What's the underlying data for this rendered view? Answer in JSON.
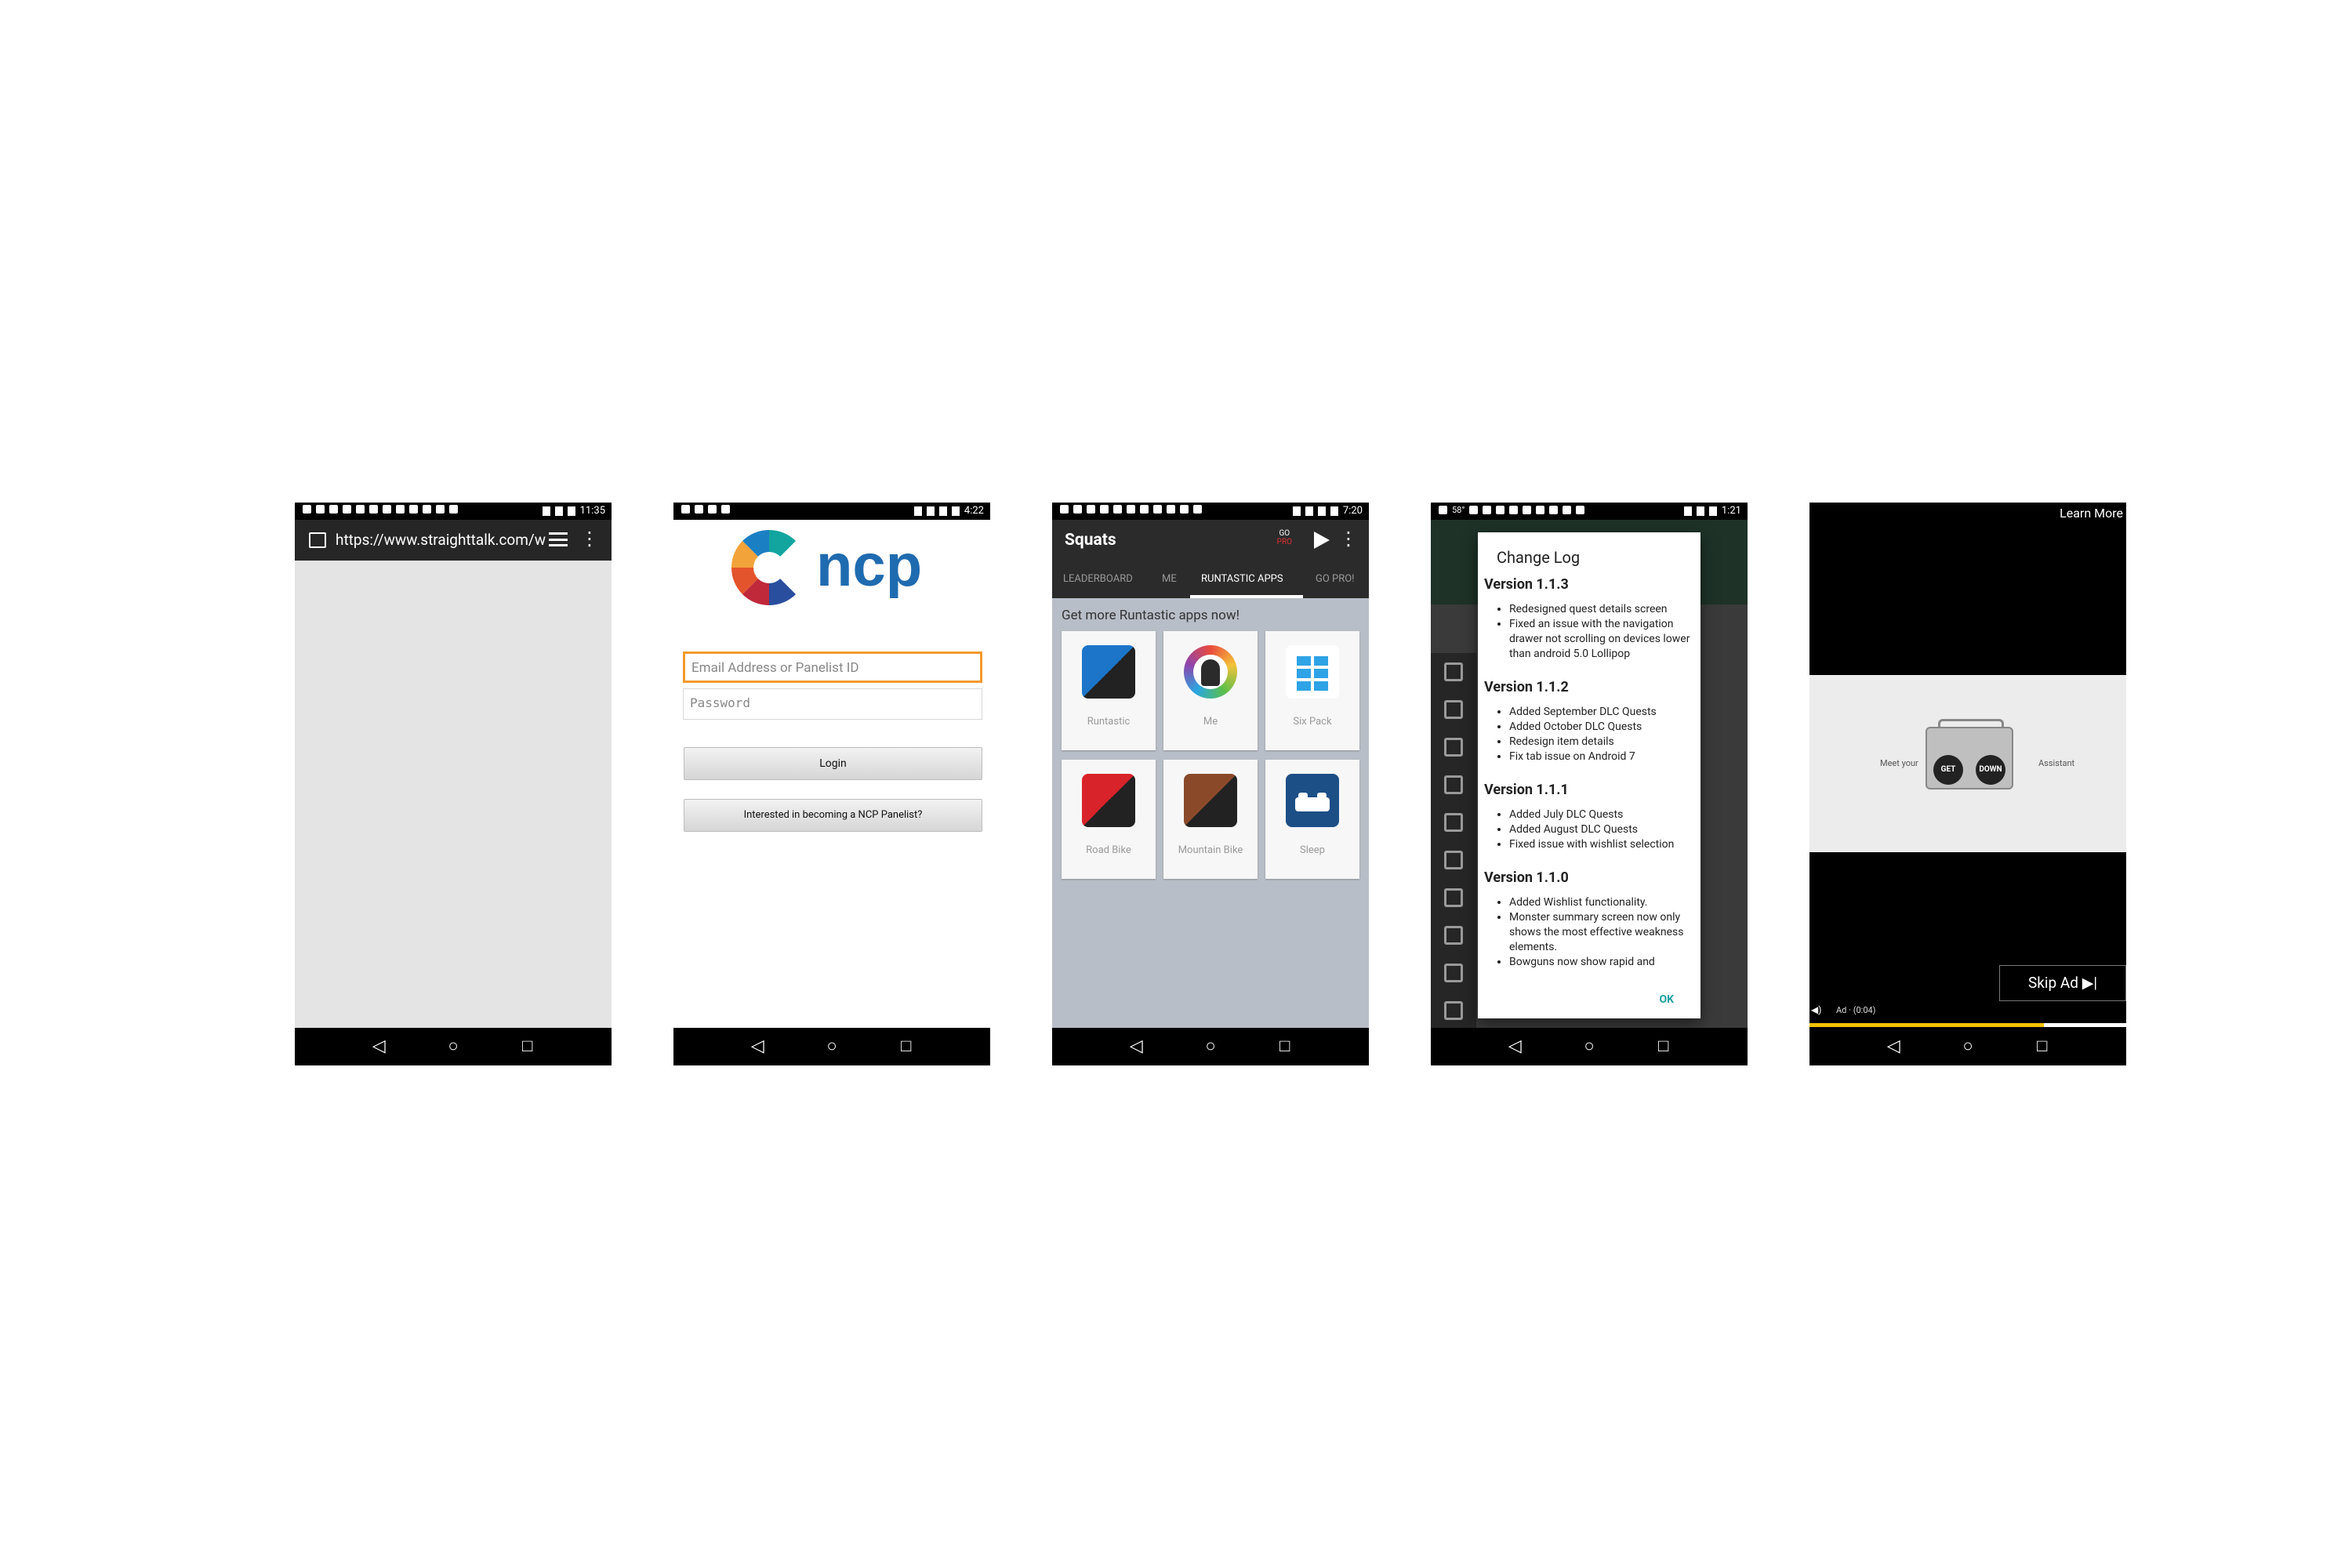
{
  "phone1": {
    "status_time": "11:35",
    "url": "https://www.straighttalk.com/w"
  },
  "phone2": {
    "status_time": "4:22",
    "logo_text": "ncp",
    "email_placeholder": "Email Address or Panelist ID",
    "password_placeholder": "Password",
    "login_label": "Login",
    "panelist_label": "Interested in becoming a NCP Panelist?"
  },
  "phone3": {
    "status_time": "7:20",
    "title": "Squats",
    "gopro_top": "GO",
    "gopro_bottom": "PRO",
    "tabs": [
      "LEADERBOARD",
      "ME",
      "RUNTASTIC APPS",
      "GO PRO!"
    ],
    "heading": "Get more Runtastic apps now!",
    "apps": [
      "Runtastic",
      "Me",
      "Six Pack",
      "Road Bike",
      "Mountain Bike",
      "Sleep"
    ]
  },
  "phone4": {
    "status_temp": "58°",
    "status_time": "1:21",
    "dialog_title": "Change Log",
    "versions": [
      {
        "title": "Version 1.1.3",
        "items": [
          "Redesigned quest details screen",
          "Fixed an issue with the navigation drawer not scrolling on devices lower than android 5.0 Lollipop"
        ]
      },
      {
        "title": "Version 1.1.2",
        "items": [
          "Added September DLC Quests",
          "Added October DLC Quests",
          "Redesign item details",
          "Fix tab issue on Android 7"
        ]
      },
      {
        "title": "Version 1.1.1",
        "items": [
          "Added July DLC Quests",
          "Added August DLC Quests",
          "Fixed issue with wishlist selection"
        ]
      },
      {
        "title": "Version 1.1.0",
        "items": [
          "Added Wishlist functionality.",
          "Monster summary screen now only shows the most effective weakness elements.",
          "Bowguns now show rapid and"
        ]
      }
    ],
    "ok_label": "OK"
  },
  "phone5": {
    "learn_more": "Learn More",
    "ad_left": "Meet your",
    "ad_right": "Assistant",
    "boombox_left": "GET",
    "boombox_right": "DOWN",
    "skip_label": "Skip Ad ▶|",
    "ad_timer": "Ad · (0:04)",
    "progress": 0.74
  },
  "colors": {
    "ncp_blue": "#1f6bb0",
    "focus_orange": "#f39a2d",
    "dialog_ok": "#1aa0a0",
    "ad_progress": "#f2c200"
  }
}
